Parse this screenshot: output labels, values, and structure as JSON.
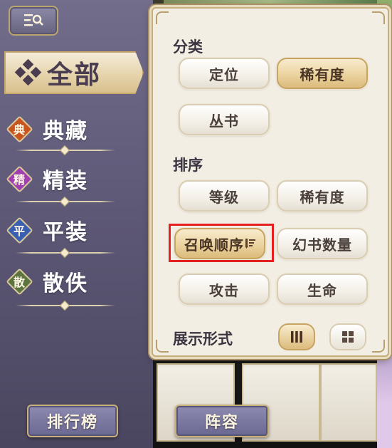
{
  "sidebar": {
    "all_label": "全部",
    "categories": [
      {
        "badge": "典",
        "label": "典藏",
        "badge_color": "#c8541e"
      },
      {
        "badge": "精",
        "label": "精装",
        "badge_color": "#a23fb0"
      },
      {
        "badge": "平",
        "label": "平装",
        "badge_color": "#3b5fb0"
      },
      {
        "badge": "散",
        "label": "散佚",
        "badge_color": "#5c7440"
      }
    ]
  },
  "bottom": {
    "ranking_label": "排行榜",
    "lineup_label": "阵容"
  },
  "filter": {
    "category_title": "分类",
    "category_options": [
      {
        "label": "定位",
        "selected": false
      },
      {
        "label": "稀有度",
        "selected": true
      },
      {
        "label": "丛书",
        "selected": false
      }
    ],
    "sort_title": "排序",
    "sort_options": [
      {
        "label": "等级",
        "selected": false
      },
      {
        "label": "稀有度",
        "selected": false
      },
      {
        "label": "召唤顺序",
        "selected": true,
        "icon": "sort-descending-icon"
      },
      {
        "label": "幻书数量",
        "selected": false
      },
      {
        "label": "攻击",
        "selected": false
      },
      {
        "label": "生命",
        "selected": false
      }
    ],
    "display_title": "展示形式",
    "display_modes": [
      {
        "icon": "list-columns-icon",
        "selected": true
      },
      {
        "icon": "grid-icon",
        "selected": false
      }
    ]
  },
  "colors": {
    "highlight": "#e52020",
    "gold": "#c8a462"
  }
}
